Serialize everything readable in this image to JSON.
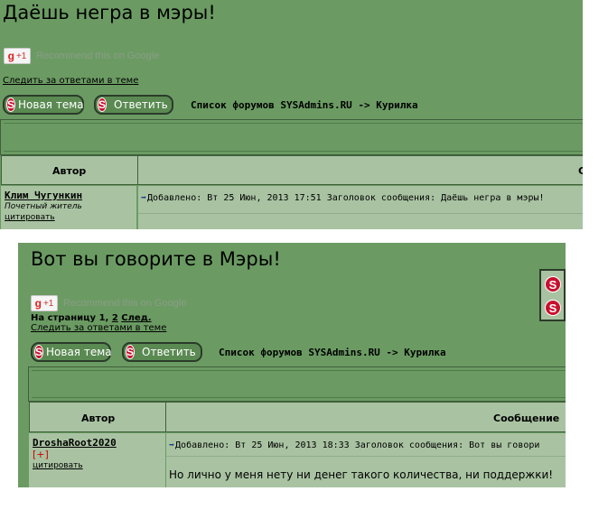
{
  "thread1": {
    "title": "Даёшь негра в мэры!",
    "gplus_label": "+1",
    "gplus_text": "Recommend this on Google",
    "watch_link": "Следить за ответами в теме",
    "new_topic": "Новая тема",
    "reply": "Ответить",
    "breadcrumb": "Список форумов SYSAdmins.RU -> Курилка",
    "col_author": "Автор",
    "col_message_partial": "С",
    "post": {
      "author": "Клим Чугункин",
      "rank": "Почетный житель",
      "quote": "цитировать",
      "meta": "Добавлено: Вт 25 Июн, 2013 17:51    Заголовок сообщения: Даёшь негра в мэры!"
    }
  },
  "thread2": {
    "title": "Вот вы говорите в Мэры!",
    "gplus_label": "+1",
    "gplus_text": "Recommend this on Google",
    "pager_prefix": "На страницу",
    "pager_current": "1,",
    "pager_page2": "2",
    "pager_next": "След.",
    "watch_link": "Следить за ответами в теме",
    "new_topic": "Новая тема",
    "reply": "Ответить",
    "breadcrumb": "Список форумов SYSAdmins.RU -> Курилка",
    "col_author": "Автор",
    "col_message": "Сообщение",
    "post": {
      "author": "DroshaRoot2020",
      "plus": "[+]",
      "quote": "цитировать",
      "meta": "Добавлено: Вт 25 Июн, 2013 18:33    Заголовок сообщения: Вот вы говори",
      "text": "Но лично у меня нету ни денег такого количества, ни поддержки!"
    }
  },
  "icon_letter": "S",
  "gplus_letter": "g"
}
